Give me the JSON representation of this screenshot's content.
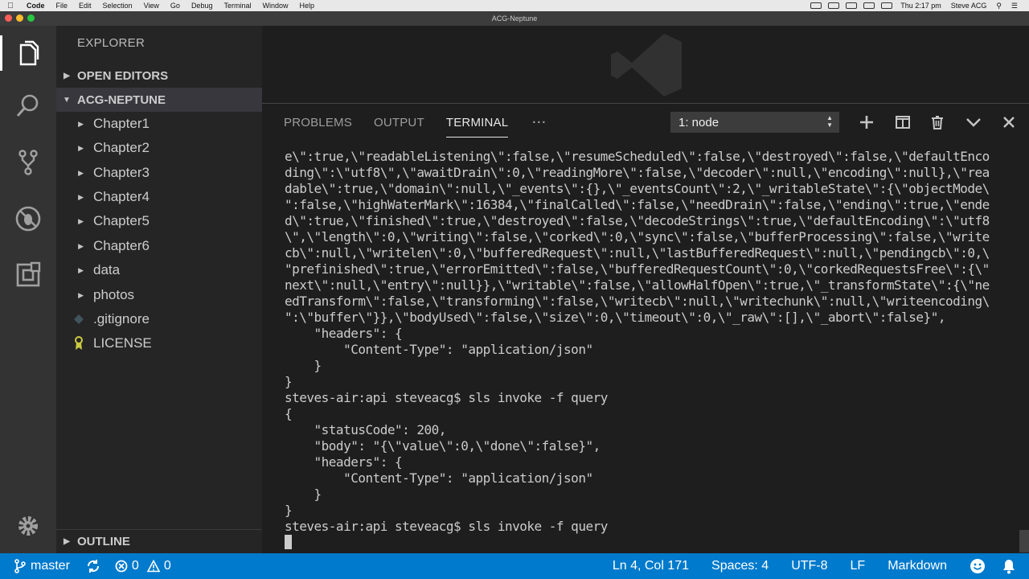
{
  "menubar": {
    "app_name": "Code",
    "items": [
      "File",
      "Edit",
      "Selection",
      "View",
      "Go",
      "Debug",
      "Terminal",
      "Window",
      "Help"
    ],
    "clock": "Thu 2:17 pm",
    "user": "Steve ACG"
  },
  "window": {
    "title": "ACG-Neptune"
  },
  "sidebar": {
    "title": "EXPLORER",
    "open_editors": "OPEN EDITORS",
    "project": "ACG-NEPTUNE",
    "items": [
      {
        "label": "Chapter1",
        "type": "folder"
      },
      {
        "label": "Chapter2",
        "type": "folder"
      },
      {
        "label": "Chapter3",
        "type": "folder"
      },
      {
        "label": "Chapter4",
        "type": "folder"
      },
      {
        "label": "Chapter5",
        "type": "folder"
      },
      {
        "label": "Chapter6",
        "type": "folder"
      },
      {
        "label": "data",
        "type": "folder"
      },
      {
        "label": "photos",
        "type": "folder"
      },
      {
        "label": ".gitignore",
        "type": "file"
      },
      {
        "label": "LICENSE",
        "type": "file"
      }
    ],
    "outline": "OUTLINE"
  },
  "panel": {
    "tabs": {
      "problems": "PROBLEMS",
      "output": "OUTPUT",
      "terminal": "TERMINAL",
      "more": "···"
    },
    "terminal_select": "1: node",
    "terminal_lines": [
      "e\\\":true,\\\"readableListening\\\":false,\\\"resumeScheduled\\\":false,\\\"destroyed\\\":false,\\\"defaultEnco",
      "ding\\\":\\\"utf8\\\",\\\"awaitDrain\\\":0,\\\"readingMore\\\":false,\\\"decoder\\\":null,\\\"encoding\\\":null},\\\"rea",
      "dable\\\":true,\\\"domain\\\":null,\\\"_events\\\":{},\\\"_eventsCount\\\":2,\\\"_writableState\\\":{\\\"objectMode\\",
      "\":false,\\\"highWaterMark\\\":16384,\\\"finalCalled\\\":false,\\\"needDrain\\\":false,\\\"ending\\\":true,\\\"ende",
      "d\\\":true,\\\"finished\\\":true,\\\"destroyed\\\":false,\\\"decodeStrings\\\":true,\\\"defaultEncoding\\\":\\\"utf8",
      "\\\",\\\"length\\\":0,\\\"writing\\\":false,\\\"corked\\\":0,\\\"sync\\\":false,\\\"bufferProcessing\\\":false,\\\"write",
      "cb\\\":null,\\\"writelen\\\":0,\\\"bufferedRequest\\\":null,\\\"lastBufferedRequest\\\":null,\\\"pendingcb\\\":0,\\",
      "\"prefinished\\\":true,\\\"errorEmitted\\\":false,\\\"bufferedRequestCount\\\":0,\\\"corkedRequestsFree\\\":{\\\"",
      "next\\\":null,\\\"entry\\\":null}},\\\"writable\\\":false,\\\"allowHalfOpen\\\":true,\\\"_transformState\\\":{\\\"ne",
      "edTransform\\\":false,\\\"transforming\\\":false,\\\"writecb\\\":null,\\\"writechunk\\\":null,\\\"writeencoding\\",
      "\":\\\"buffer\\\"}},\\\"bodyUsed\\\":false,\\\"size\\\":0,\\\"timeout\\\":0,\\\"_raw\\\":[],\\\"_abort\\\":false}\",",
      "    \"headers\": {",
      "        \"Content-Type\": \"application/json\"",
      "    }",
      "}",
      "steves-air:api steveacg$ sls invoke -f query",
      "{",
      "    \"statusCode\": 200,",
      "    \"body\": \"{\\\"value\\\":0,\\\"done\\\":false}\",",
      "    \"headers\": {",
      "        \"Content-Type\": \"application/json\"",
      "    }",
      "}",
      "steves-air:api steveacg$ sls invoke -f query"
    ]
  },
  "statusbar": {
    "branch": "master",
    "errors": "0",
    "warnings": "0",
    "position": "Ln 4, Col 171",
    "spaces": "Spaces: 4",
    "encoding": "UTF-8",
    "eol": "LF",
    "language": "Markdown"
  },
  "colors": {
    "statusbar": "#007acc",
    "sidebar": "#252526",
    "activitybar": "#333333",
    "editor": "#1e1e1e"
  }
}
